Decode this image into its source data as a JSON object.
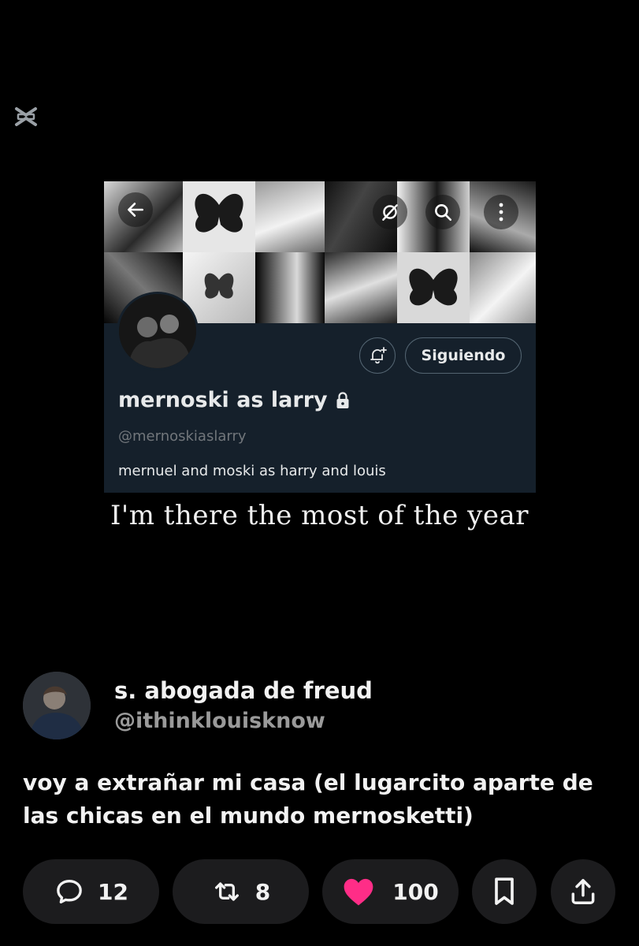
{
  "watermark": {
    "icon": "capcut-logo-icon"
  },
  "profile_card": {
    "back_icon": "arrow-left-icon",
    "grok_icon": "grok-icon",
    "search_icon": "search-icon",
    "more_icon": "more-vertical-icon",
    "notify_icon": "bell-plus-icon",
    "follow_label": "Siguiendo",
    "display_name": "mernoski as larry",
    "lock_icon": "lock-icon",
    "handle": "@mernoskiaslarry",
    "bio": "mernuel and moski as harry and louis"
  },
  "video_caption": "I'm there the most of the year",
  "post": {
    "author_name": "s. abogada de freud",
    "author_handle": "@ithinklouisknow",
    "text": "voy a extrañar mi casa (el lugarcito aparte de las chicas en el mundo mernosketti)"
  },
  "actions": {
    "replies": {
      "icon": "comment-icon",
      "count": "12"
    },
    "reposts": {
      "icon": "repost-icon",
      "count": "8"
    },
    "likes": {
      "icon": "heart-icon",
      "count": "100",
      "color": "#ff2d87"
    },
    "bookmark": {
      "icon": "bookmark-icon"
    },
    "share": {
      "icon": "share-icon"
    }
  },
  "colors": {
    "background": "#000000",
    "card": "#15202b",
    "pill": "#1c1c1e",
    "like": "#ff2d87"
  }
}
